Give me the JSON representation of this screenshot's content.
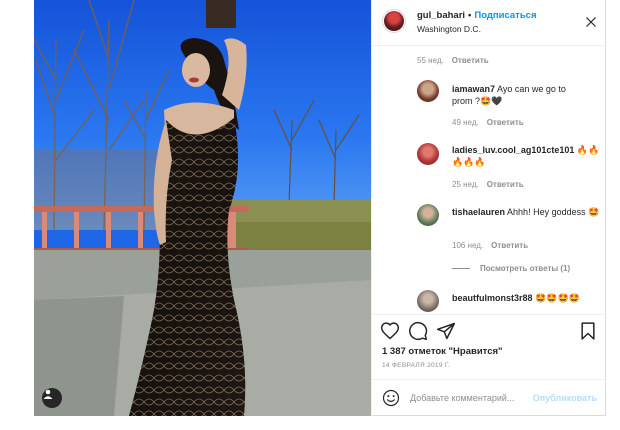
{
  "post": {
    "author": {
      "username": "gul_bahari",
      "follow_label": "Подписаться",
      "location": "Washington D.C."
    },
    "comments": [
      {
        "username": "",
        "text": "",
        "age": "55 нед.",
        "reply_label": "Ответить"
      },
      {
        "username": "iamawan7",
        "text": "Ayo can we go to prom ?🤩🖤",
        "age": "49 нед.",
        "reply_label": "Ответить"
      },
      {
        "username": "ladies_luv.cool_ag101cte101",
        "text": "🔥🔥🔥🔥🔥",
        "age": "25 нед.",
        "reply_label": "Ответить"
      },
      {
        "username": "tishaelauren",
        "text": "Ahhh! Hey goddess 🤩",
        "age": "106 нед.",
        "reply_label": "Ответить",
        "view_replies": "Посмотреть ответы (1)"
      },
      {
        "username": "beautfulmonst3r88",
        "text": "🤩🤩🤩🤩",
        "age": "",
        "reply_label": ""
      }
    ],
    "likes_text": "1 387 отметок \"Нравится\"",
    "date_text": "14 ФЕВРАЛЯ 2019 Г.",
    "add_comment": {
      "placeholder": "Добавьте комментарий...",
      "publish_label": "Опубликовать"
    }
  },
  "icons": {
    "like": "heart-icon",
    "comment": "comment-icon",
    "share": "paper-plane-icon",
    "save": "bookmark-icon",
    "emoji": "smiley-icon",
    "more": "more-icon",
    "tag": "user-tag-icon"
  },
  "colors": {
    "link_blue": "#0095f6",
    "publish_disabled": "#b2dffc",
    "muted_text": "#8e8e8e",
    "border": "#efefef"
  }
}
